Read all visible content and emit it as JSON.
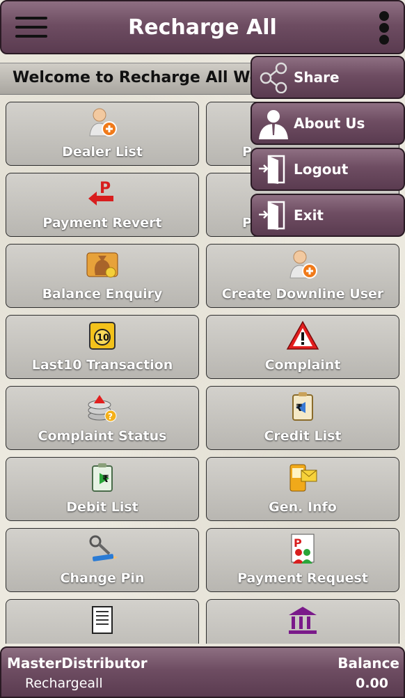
{
  "app": {
    "title": "Recharge All"
  },
  "welcome": {
    "text": "Welcome to Recharge All    Welcome to Recharge All"
  },
  "tiles": [
    {
      "label": "Dealer List",
      "icon": "add-user-icon"
    },
    {
      "label": "P",
      "icon": "tile-icon"
    },
    {
      "label": "Payment Revert",
      "icon": "payment-revert-icon"
    },
    {
      "label": "P",
      "icon": "tile-icon"
    },
    {
      "label": "Balance Enquiry",
      "icon": "money-bag-icon"
    },
    {
      "label": "Create Downline User",
      "icon": "add-user-icon"
    },
    {
      "label": "Last10 Transaction",
      "icon": "calendar-10-icon"
    },
    {
      "label": "Complaint",
      "icon": "warning-icon"
    },
    {
      "label": "Complaint Status",
      "icon": "coins-warning-icon"
    },
    {
      "label": "Credit List",
      "icon": "rupee-clipboard-icon"
    },
    {
      "label": "Debit List",
      "icon": "rupee-clipboard-icon"
    },
    {
      "label": "Gen. Info",
      "icon": "phone-mail-icon"
    },
    {
      "label": "Change Pin",
      "icon": "key-pencil-icon"
    },
    {
      "label": "Payment Request",
      "icon": "payment-request-icon"
    },
    {
      "label": "",
      "icon": "document-list-icon"
    },
    {
      "label": "",
      "icon": "bank-icon"
    }
  ],
  "menu": [
    {
      "label": "Share",
      "icon": "share-icon"
    },
    {
      "label": "About Us",
      "icon": "user-icon"
    },
    {
      "label": "Logout",
      "icon": "door-exit-icon"
    },
    {
      "label": "Exit",
      "icon": "door-exit-icon"
    }
  ],
  "footer": {
    "role": "MasterDistributor",
    "user": "Rechargeall",
    "balance_label": "Balance",
    "balance_value": "0.00"
  }
}
